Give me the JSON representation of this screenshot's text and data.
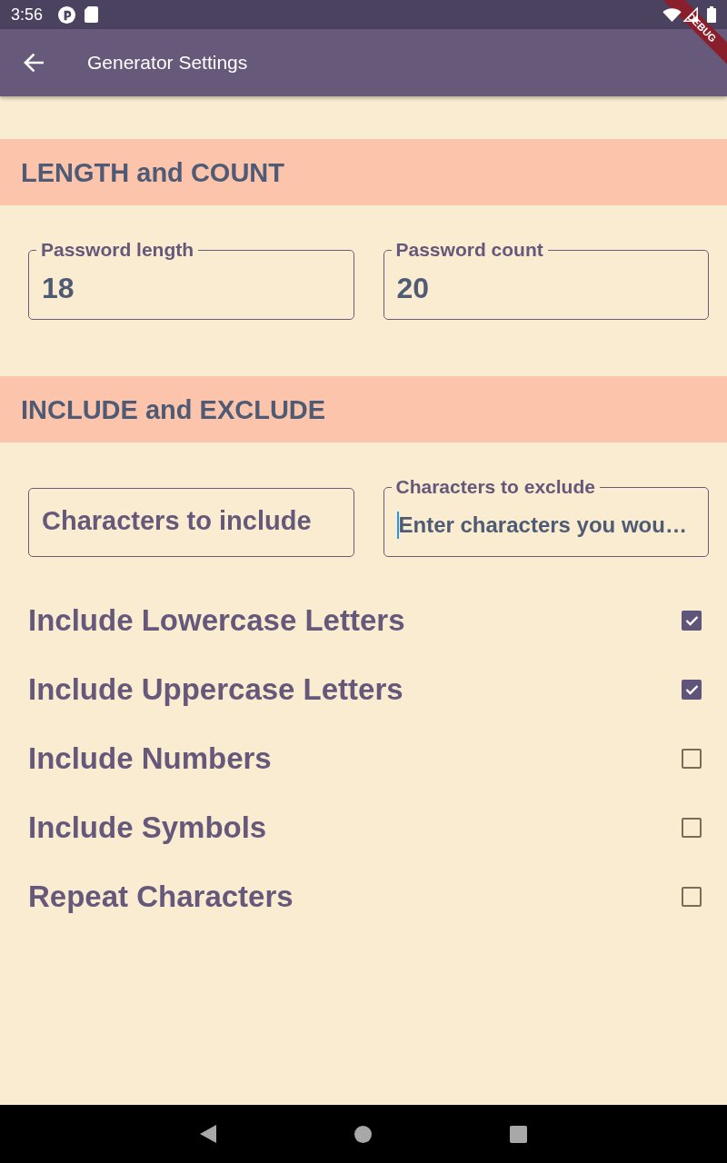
{
  "status_bar": {
    "time": "3:56"
  },
  "debug_banner": "DEBUG",
  "app_bar": {
    "title": "Generator Settings"
  },
  "sections": [
    {
      "title": "LENGTH and COUNT",
      "fields": [
        {
          "label": "Password length",
          "label_floating": true,
          "value": "18",
          "focused": false
        },
        {
          "label": "Password count",
          "label_floating": true,
          "value": "20",
          "focused": false
        }
      ]
    },
    {
      "title": "INCLUDE and EXCLUDE",
      "fields": [
        {
          "label": "Characters to include",
          "label_floating": false,
          "focused": false
        },
        {
          "label": "Characters to exclude",
          "label_floating": true,
          "placeholder": "Enter characters you wou…",
          "focused": true
        }
      ]
    }
  ],
  "options": [
    {
      "label": "Include Lowercase Letters",
      "checked": true
    },
    {
      "label": "Include Uppercase Letters",
      "checked": true
    },
    {
      "label": "Include Numbers",
      "checked": false
    },
    {
      "label": "Include Symbols",
      "checked": false
    },
    {
      "label": "Repeat Characters",
      "checked": false
    }
  ]
}
